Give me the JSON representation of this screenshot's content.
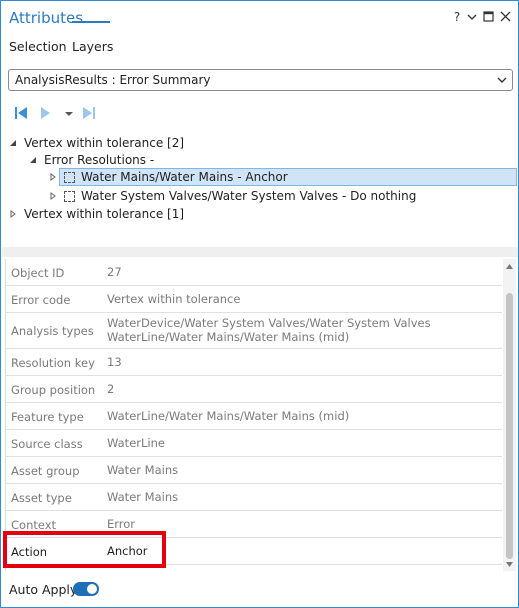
{
  "window": {
    "title": "Attributes",
    "controls": {
      "help": "?",
      "menu": "chevron-down-icon",
      "maximize": "maximize-icon",
      "close": "close-icon"
    }
  },
  "tabs": [
    {
      "label": "Selection",
      "active": false
    },
    {
      "label": "Layers",
      "active": true
    }
  ],
  "layer_select": {
    "value": "AnalysisResults : Error Summary"
  },
  "nav_toolbar": {
    "icons": [
      "first-record-icon",
      "next-record-icon",
      "next-dropdown-icon",
      "last-record-icon"
    ]
  },
  "tree": [
    {
      "label": "Vertex within tolerance [2]",
      "level": 0,
      "expanded": true
    },
    {
      "label": "Error Resolutions -",
      "level": 1,
      "expanded": true
    },
    {
      "label": "Water Mains/Water Mains - Anchor",
      "level": 2,
      "expanded": false,
      "selected": true
    },
    {
      "label": "Water System Valves/Water System Valves - Do nothing",
      "level": 2,
      "expanded": false,
      "selected": false
    },
    {
      "label": "Vertex within tolerance [1]",
      "level": 0,
      "expanded": false
    }
  ],
  "properties": [
    {
      "key": "Object ID",
      "value": "27"
    },
    {
      "key": "Error code",
      "value": "Vertex within tolerance"
    },
    {
      "key": "Analysis types",
      "value": "WaterDevice/Water System Valves/Water System Valves",
      "value2": "WaterLine/Water Mains/Water Mains (mid)"
    },
    {
      "key": "Resolution key",
      "value": "13"
    },
    {
      "key": "Group position",
      "value": "2"
    },
    {
      "key": "Feature type",
      "value": "WaterLine/Water Mains/Water Mains (mid)"
    },
    {
      "key": "Source class",
      "value": "WaterLine"
    },
    {
      "key": "Asset group",
      "value": "Water Mains"
    },
    {
      "key": "Asset type",
      "value": "Water Mains"
    },
    {
      "key": "Context",
      "value": "Error"
    },
    {
      "key": "Action",
      "value": "Anchor"
    }
  ],
  "footer": {
    "auto_apply_label": "Auto Apply",
    "auto_apply_on": true
  },
  "colors": {
    "accent": "#2a7bbf",
    "highlight": "#e3000f",
    "selection": "#cfe4f7",
    "toggle": "#1e6fb8"
  }
}
